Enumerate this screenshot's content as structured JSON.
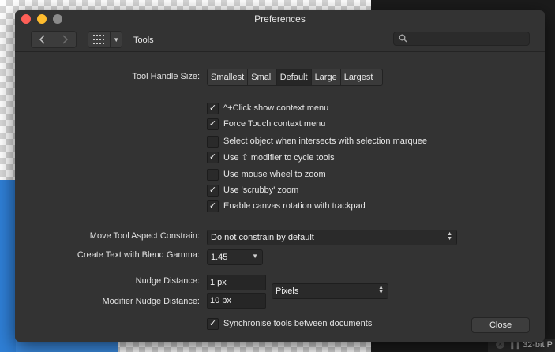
{
  "window": {
    "title": "Preferences"
  },
  "toolbar": {
    "section_title": "Tools",
    "search_placeholder": ""
  },
  "tool_handle_size": {
    "label": "Tool Handle Size:",
    "options": [
      "Smallest",
      "Small",
      "Default",
      "Large",
      "Largest"
    ],
    "selected": "Default"
  },
  "checkboxes": [
    {
      "label": "^+Click show context menu",
      "checked": true
    },
    {
      "label": "Force Touch context menu",
      "checked": true
    },
    {
      "label": "Select object when intersects with selection marquee",
      "checked": false
    },
    {
      "label": "Use ⇧ modifier to cycle tools",
      "checked": true
    },
    {
      "label": "Use mouse wheel to zoom",
      "checked": false
    },
    {
      "label": "Use 'scrubby' zoom",
      "checked": true
    },
    {
      "label": "Enable canvas rotation with trackpad",
      "checked": true
    }
  ],
  "aspect_constrain": {
    "label": "Move Tool Aspect Constrain:",
    "value": "Do not constrain by default"
  },
  "blend_gamma": {
    "label": "Create Text with Blend Gamma:",
    "value": "1.45"
  },
  "nudge": {
    "label": "Nudge Distance:",
    "value": "1 px"
  },
  "modifier_nudge": {
    "label": "Modifier Nudge Distance:",
    "value": "10 px"
  },
  "units": {
    "value": "Pixels"
  },
  "sync": {
    "label": "Synchronise tools between documents",
    "checked": true
  },
  "close_label": "Close",
  "status": {
    "text": "32-bit P"
  },
  "check_glyph": "✓"
}
